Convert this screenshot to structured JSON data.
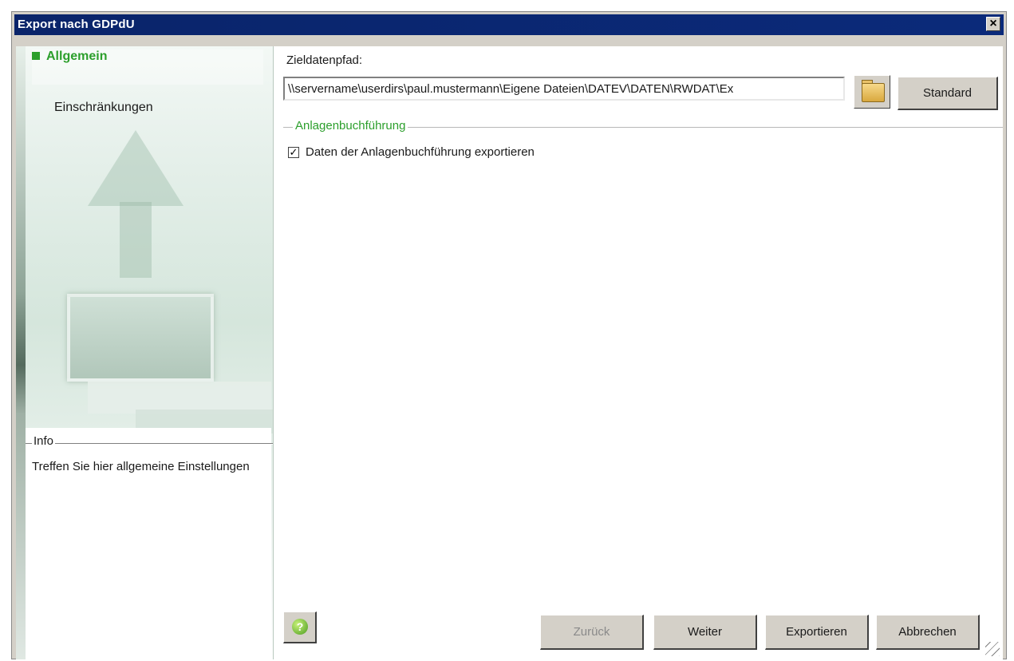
{
  "window": {
    "title": "Export nach GDPdU",
    "close_symbol": "×"
  },
  "sidebar": {
    "items": [
      {
        "label": "Allgemein",
        "active": true
      },
      {
        "label": "Einschränkungen",
        "active": false
      }
    ],
    "info": {
      "legend": "Info",
      "text": "Treffen Sie hier allgemeine Einstellungen"
    }
  },
  "main": {
    "target_label": "Zieldatenpfad:",
    "target_path": "\\\\servername\\userdirs\\paul.mustermann\\Eigene Dateien\\DATEV\\DATEN\\RWDAT\\Ex",
    "browse_icon": "folder-icon",
    "standard_button": "Standard",
    "group": {
      "legend": "Anlagenbuchführung",
      "checkbox_label": "Daten der Anlagenbuchführung exportieren",
      "checkbox_checked": true,
      "checkbox_mark": "✓"
    }
  },
  "footer": {
    "help_icon": "help-icon",
    "help_symbol": "?",
    "back_button": "Zurück",
    "next_button": "Weiter",
    "export_button": "Exportieren",
    "cancel_button": "Abbrechen"
  },
  "colors": {
    "title_bar": "#0a246a",
    "accent_green": "#2c9f2c",
    "disabled_text": "#8a8a8a"
  }
}
